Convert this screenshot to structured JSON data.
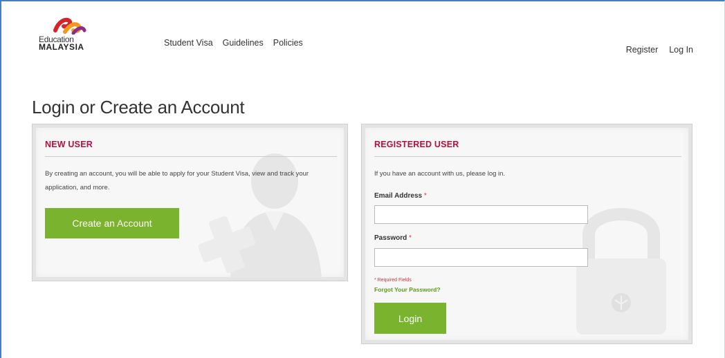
{
  "brand": {
    "line1": "Education",
    "line2": "MALAYSIA",
    "colors": {
      "red": "#d4252b",
      "orange": "#f39a1e",
      "purple": "#8a2d8c"
    }
  },
  "nav": {
    "items": [
      "Student Visa",
      "Guidelines",
      "Policies"
    ]
  },
  "auth": {
    "register": "Register",
    "login": "Log In"
  },
  "page": {
    "title": "Login or Create an Account"
  },
  "new_user": {
    "heading": "NEW USER",
    "description": "By creating an account, you will be able to apply for your Student Visa, view and track your application, and more.",
    "button": "Create an Account",
    "watermark_icon": "user-plus-icon"
  },
  "registered_user": {
    "heading": "REGISTERED USER",
    "intro": "If you have an account with us, please log in.",
    "email_label": "Email Address",
    "email_value": "",
    "password_label": "Password",
    "password_value": "",
    "required_marker": "*",
    "required_note": "* Required Fields",
    "forgot_link": "Forgot Your Password?",
    "button": "Login",
    "watermark_icon": "padlock-icon"
  },
  "colors": {
    "accent_green": "#7ab32e",
    "heading_red": "#b5103c",
    "frame_blue": "#4a7ebb"
  }
}
